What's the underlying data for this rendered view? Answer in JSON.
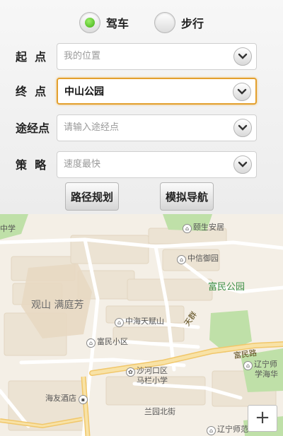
{
  "route_mode": {
    "drive_label": "驾车",
    "walk_label": "步行",
    "selected": "drive"
  },
  "form": {
    "start": {
      "label": "起  点",
      "value": "我的位置"
    },
    "end": {
      "label": "终  点",
      "value": "中山公园"
    },
    "waypoint": {
      "label": "途经点",
      "placeholder": "请输入途经点"
    },
    "strategy": {
      "label": "策  略",
      "value": "速度最快"
    }
  },
  "buttons": {
    "plan": "路径规划",
    "simulate": "模拟导航"
  },
  "map": {
    "labels": {
      "poi_yangsheng": "颐生安居",
      "poi_zhongxin": "中信御园",
      "park_fumin": "富民公园",
      "area_guanshan": "观山 满庭芳",
      "poi_zhonghai": "中海天赋山",
      "road_tianqun": "天群",
      "poi_fumin_xiaoqu": "富民小区",
      "poi_shahekou": "沙河口区",
      "poi_malan": "马栏小学",
      "road_fumin": "富民路",
      "poi_haiyou": "海友酒店",
      "poi_liaoning1": "辽宁师",
      "poi_liaoning1b": "学海华",
      "road_lanyuan": "兰园北街",
      "poi_liaoning2": "辽宁师范",
      "edge_zhong": "中学"
    },
    "zoom_in": "+",
    "colors": {
      "park": "#bfe0a8",
      "main_road": "#f6d98b",
      "block": "#e9e2d4"
    }
  }
}
